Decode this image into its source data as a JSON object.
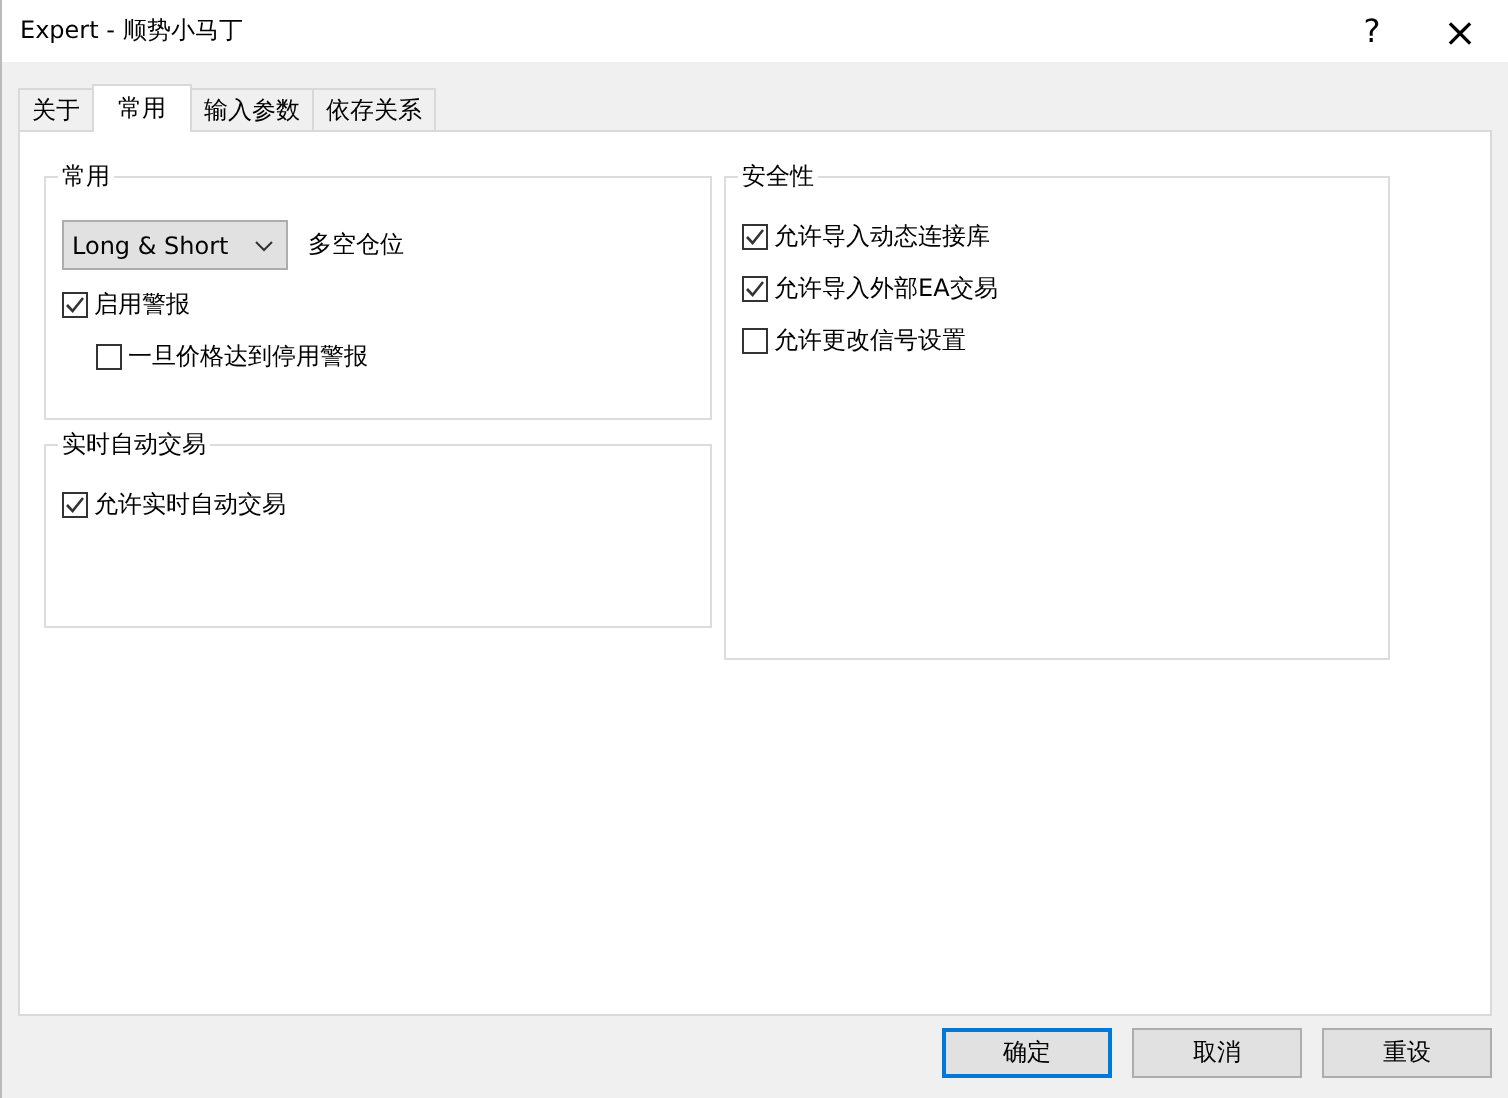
{
  "window": {
    "title": "Expert - 顺势小马丁",
    "help": "?",
    "close": "×"
  },
  "tabs": [
    {
      "label": "关于",
      "selected": false
    },
    {
      "label": "常用",
      "selected": true
    },
    {
      "label": "输入参数",
      "selected": false
    },
    {
      "label": "依存关系",
      "selected": false
    }
  ],
  "groups": [
    {
      "title": "常用",
      "items": [
        {
          "kind": "dropdown",
          "value": "Long & Short",
          "caption": "多空仓位"
        },
        {
          "kind": "checkbox",
          "label": "启用警报",
          "checked": true,
          "indented": false
        },
        {
          "kind": "checkbox",
          "label": "一旦价格达到停用警报",
          "checked": false,
          "indented": true
        }
      ]
    },
    {
      "title": "实时自动交易",
      "items": [
        {
          "kind": "checkbox",
          "label": "允许实时自动交易",
          "checked": true,
          "indented": false
        }
      ]
    },
    {
      "title": "安全性",
      "items": [
        {
          "kind": "checkbox",
          "label": "允许导入动态连接库",
          "checked": true,
          "indented": false
        },
        {
          "kind": "checkbox",
          "label": "允许导入外部EA交易",
          "checked": true,
          "indented": false
        },
        {
          "kind": "checkbox",
          "label": "允许更改信号设置",
          "checked": false,
          "indented": false
        }
      ]
    }
  ],
  "buttons": [
    {
      "label": "确定",
      "default": true
    },
    {
      "label": "取消",
      "default": false
    },
    {
      "label": "重设",
      "default": false
    }
  ]
}
